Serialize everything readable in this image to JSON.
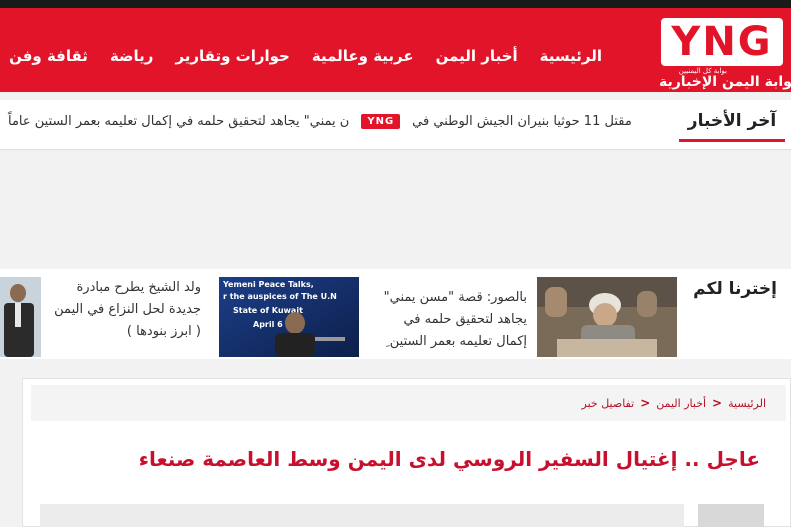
{
  "header": {
    "logo_letters": "YNG",
    "logo_tagline": "بوابة كل اليمنيين",
    "logo_name": "بوابة اليمن الإخبارية",
    "nav": [
      {
        "label": "الرئيسية",
        "name": "nav-home"
      },
      {
        "label": "أخبار اليمن",
        "name": "nav-yemen-news"
      },
      {
        "label": "عربية وعالمية",
        "name": "nav-arab-world"
      },
      {
        "label": "حوارات وتقارير",
        "name": "nav-interviews-reports"
      },
      {
        "label": "رياضة",
        "name": "nav-sports"
      },
      {
        "label": "ثقافة وفن",
        "name": "nav-culture-art"
      }
    ]
  },
  "ticker": {
    "title": "آخر الأخبار",
    "item_1": "ن يمني\" يجاهد لتحقيق حلمه في إكمال تعليمه بعمر الستين عاماً",
    "logo": "YNG",
    "item_2": "مقتل 11 حوثيا بنيران الجيش الوطني في"
  },
  "picks": {
    "title": "إخترنا لكم",
    "items": [
      {
        "text": "بالصور: قصة \"مسن يمني\" يجاهد لتحقيق حلمه في إكمال تعليمه بعمر الستين ِ"
      },
      {
        "img_line1": "Yemeni Peace Talks,",
        "img_line2": "r the auspices of The U.N",
        "img_line3": "State of Kuwait",
        "img_line4": "April 6"
      },
      {
        "text": "ولد الشيخ يطرح مبادرة جديدة لحل النزاع في اليمن ( ابرز بنودها )"
      }
    ]
  },
  "breadcrumb": {
    "home": "الرئيسية",
    "section": "أخبار اليمن",
    "current": "تفاصيل خبر"
  },
  "article": {
    "headline": "عاجل .. إغتيال السفير الروسي لدى اليمن وسط العاصمة صنعاء"
  },
  "colors": {
    "brand_red": "#e1142a",
    "headline_red": "#c8102e"
  }
}
